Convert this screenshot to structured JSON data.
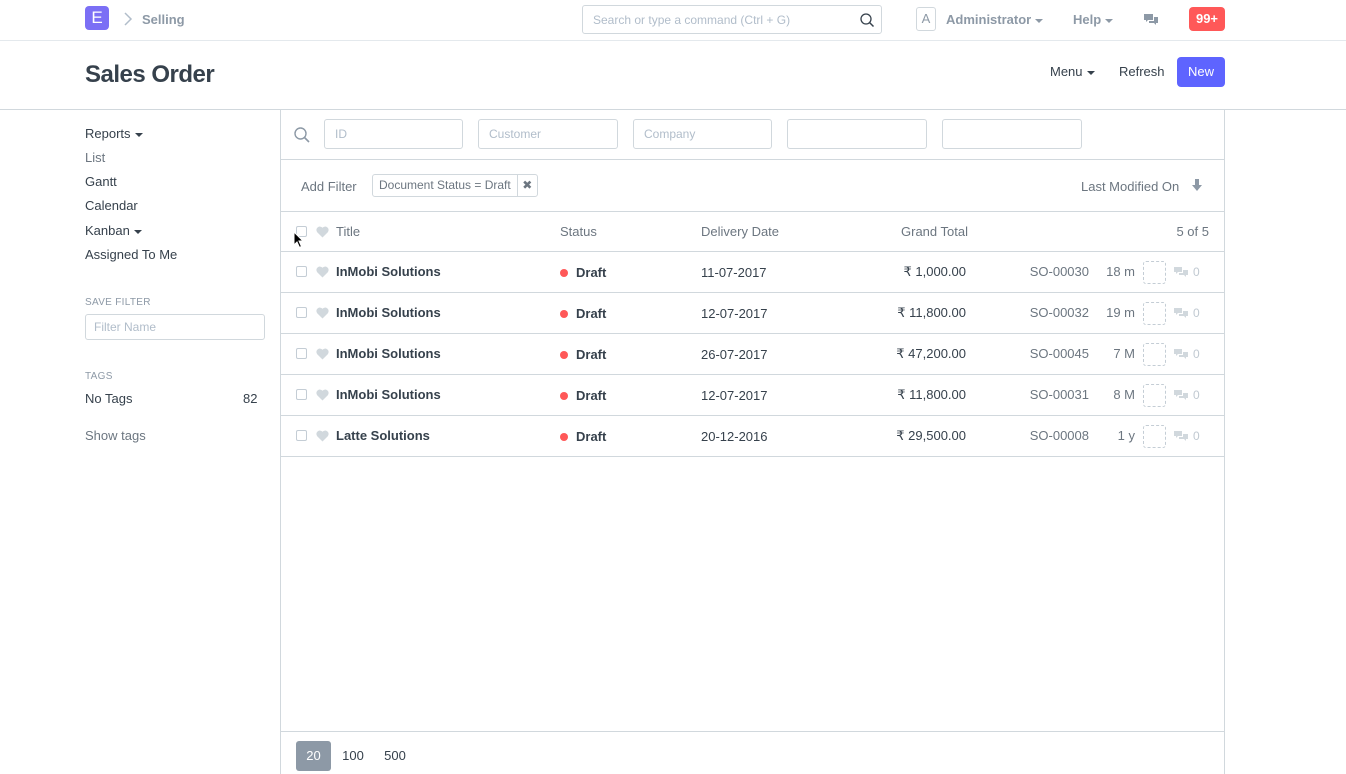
{
  "navbar": {
    "logo_letter": "E",
    "breadcrumb": "Selling",
    "search_placeholder": "Search or type a command (Ctrl + G)",
    "avatar_letter": "A",
    "user": "Administrator",
    "help": "Help",
    "notifications": "99+"
  },
  "page": {
    "title": "Sales Order",
    "menu_label": "Menu",
    "refresh_label": "Refresh",
    "new_label": "New"
  },
  "sidebar": {
    "items": [
      {
        "label": "Reports"
      },
      {
        "label": "List"
      },
      {
        "label": "Gantt"
      },
      {
        "label": "Calendar"
      },
      {
        "label": "Kanban"
      },
      {
        "label": "Assigned To Me"
      }
    ],
    "save_filter_caption": "SAVE FILTER",
    "filter_name_placeholder": "Filter Name",
    "tags_caption": "TAGS",
    "no_tags_label": "No Tags",
    "no_tags_count": "82",
    "show_tags": "Show tags"
  },
  "filters": {
    "id_placeholder": "ID",
    "customer_placeholder": "Customer",
    "company_placeholder": "Company",
    "add_filter": "Add Filter",
    "active_filter": "Document Status = Draft",
    "remove_icon": "✖",
    "sort_label": "Last Modified On"
  },
  "list": {
    "columns": {
      "title": "Title",
      "status": "Status",
      "delivery_date": "Delivery Date",
      "grand_total": "Grand Total",
      "count": "5 of 5"
    },
    "rows": [
      {
        "title": "InMobi Solutions",
        "status": "Draft",
        "date": "11-07-2017",
        "total": "₹ 1,000.00",
        "id": "SO-00030",
        "modified": "18 m",
        "comments": "0"
      },
      {
        "title": "InMobi Solutions",
        "status": "Draft",
        "date": "12-07-2017",
        "total": "₹ 11,800.00",
        "id": "SO-00032",
        "modified": "19 m",
        "comments": "0"
      },
      {
        "title": "InMobi Solutions",
        "status": "Draft",
        "date": "26-07-2017",
        "total": "₹ 47,200.00",
        "id": "SO-00045",
        "modified": "7 M",
        "comments": "0"
      },
      {
        "title": "InMobi Solutions",
        "status": "Draft",
        "date": "12-07-2017",
        "total": "₹ 11,800.00",
        "id": "SO-00031",
        "modified": "8 M",
        "comments": "0"
      },
      {
        "title": "Latte Solutions",
        "status": "Draft",
        "date": "20-12-2016",
        "total": "₹ 29,500.00",
        "id": "SO-00008",
        "modified": "1 y",
        "comments": "0"
      }
    ],
    "page_sizes": [
      "20",
      "100",
      "500"
    ],
    "active_page_size": "20"
  },
  "colors": {
    "accent": "#5e64ff",
    "logo": "#7b6ff5",
    "draft_indicator": "#ff5858",
    "notification": "#ff5858"
  }
}
